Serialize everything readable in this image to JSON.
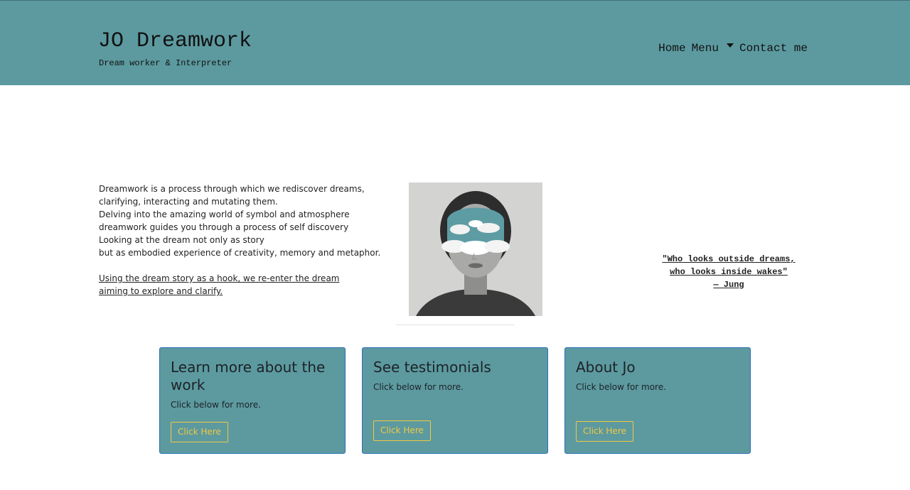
{
  "header": {
    "brand_title": "JO Dreamwork",
    "brand_subtitle": "Dream worker & Interpreter",
    "nav": {
      "home": "Home",
      "menu": "Menu",
      "contact": "Contact me"
    },
    "background_color": "#5c9aa0"
  },
  "intro": {
    "lines": [
      "Dreamwork is a process through which we rediscover dreams,",
      "clarifying, interacting and mutating them.",
      "Delving into the amazing world of symbol and atmosphere",
      "dreamwork guides you through a process of self discovery",
      "Looking at the dream not only as story",
      "but as embodied experience of creativity, memory and metaphor."
    ],
    "hook_link": "Using the dream story as a hook, we re-enter the dream aiming to explore and clarify."
  },
  "image": {
    "icon": "portrait-with-clouds-image"
  },
  "quote": {
    "line1": "\"Who looks outside dreams,",
    "line2": "who looks inside wakes\"",
    "attribution": "— Jung"
  },
  "cards": [
    {
      "title": "Learn more about the work",
      "text": "Click below for more.",
      "button": "Click Here"
    },
    {
      "title": "See testimonials",
      "text": "Click below for more.",
      "button": "Click Here"
    },
    {
      "title": "About Jo",
      "text": "Click below for more.",
      "button": "Click Here"
    }
  ],
  "colors": {
    "accent": "#5c9aa0",
    "button_outline": "#f3c840",
    "card_border": "#2b6fb8"
  }
}
